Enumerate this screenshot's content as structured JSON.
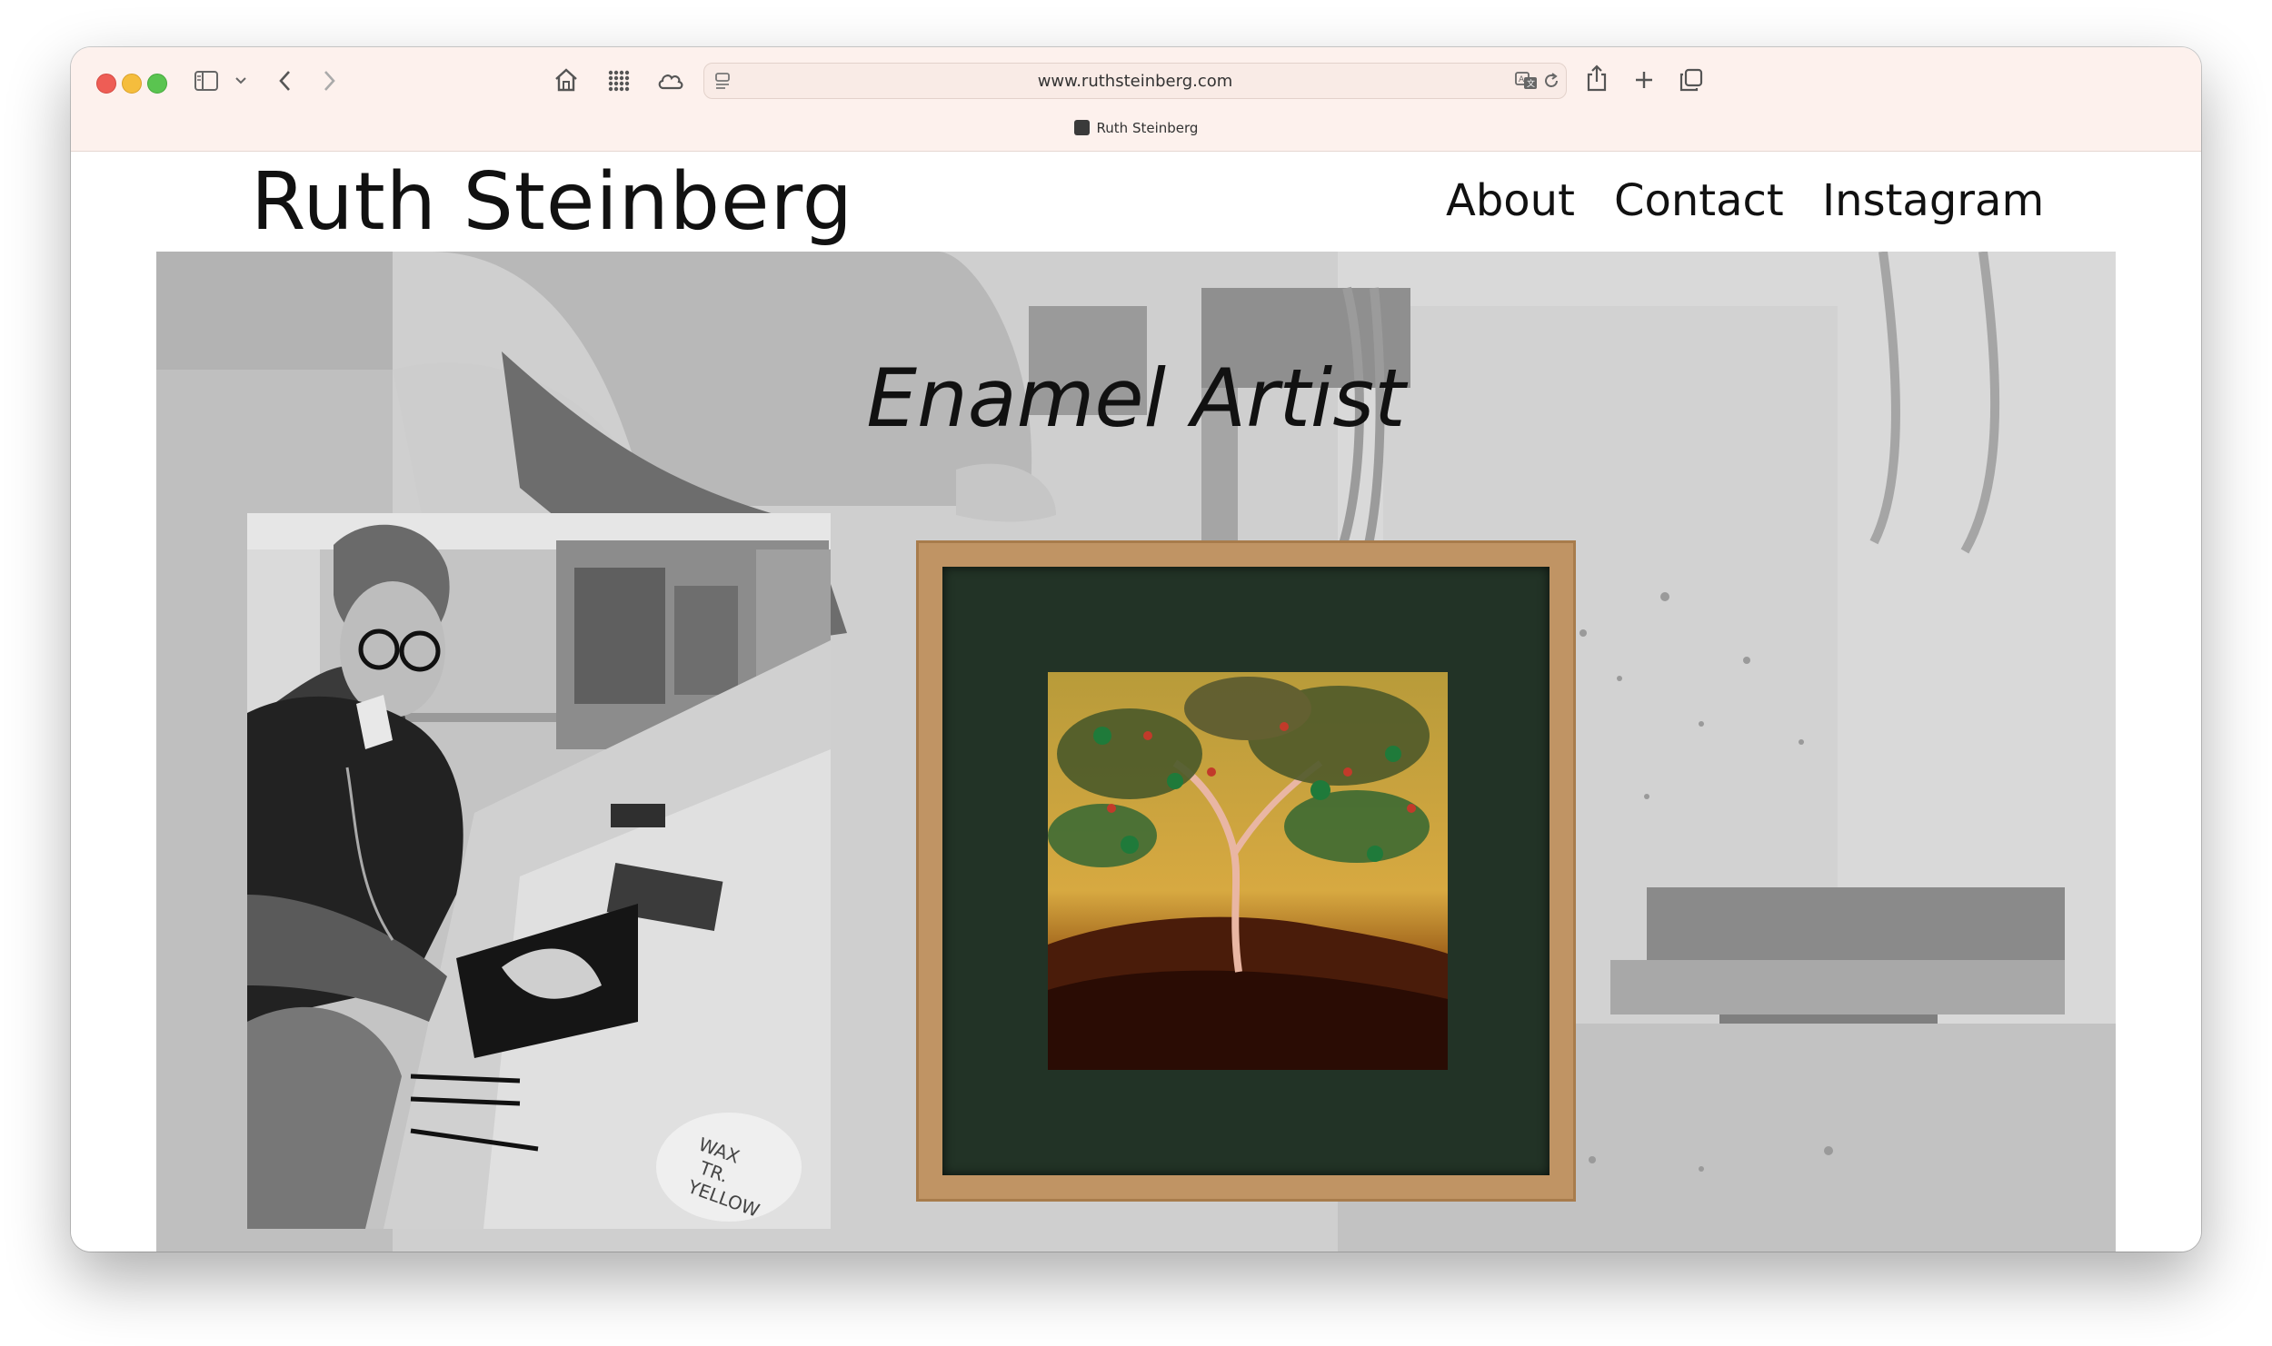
{
  "browser": {
    "url": "www.ruthsteinberg.com",
    "tab_title": "Ruth Steinberg"
  },
  "site": {
    "title": "Ruth Steinberg",
    "nav": [
      "About",
      "Contact",
      "Instagram"
    ],
    "tagline": "Enamel Artist"
  },
  "photos": {
    "jar_label": [
      "WAX",
      "TR.",
      "YELLOW"
    ]
  },
  "colors": {
    "toolbar_bg": "#fdf1ed",
    "frame_wood": "#c09464",
    "mat_green": "#223326",
    "art_gold": "#c9a23a"
  },
  "icons": {
    "sidebar": "sidebar-icon",
    "back": "chevron-left-icon",
    "forward": "chevron-right-icon",
    "home": "home-icon",
    "grid": "grid-icon",
    "cloud": "cloud-icon",
    "reader": "reader-icon",
    "translate": "translate-icon",
    "reload": "reload-icon",
    "share": "share-icon",
    "new_tab": "plus-icon",
    "tabs": "tabs-overview-icon"
  }
}
